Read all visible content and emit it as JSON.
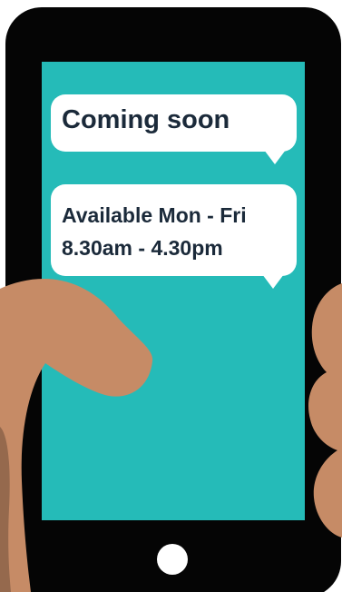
{
  "screen": {
    "background_color": "#25bbb8",
    "bezel_color": "#050505",
    "skin_color": "#c68b66"
  },
  "messages": [
    {
      "text": "Coming soon"
    },
    {
      "lines": [
        "Available Mon - Fri",
        "8.30am - 4.30pm"
      ]
    }
  ],
  "icons": [
    "phone-icon",
    "thumb-icon",
    "finger-icon",
    "home-button-icon",
    "chat-bubble-icon"
  ]
}
